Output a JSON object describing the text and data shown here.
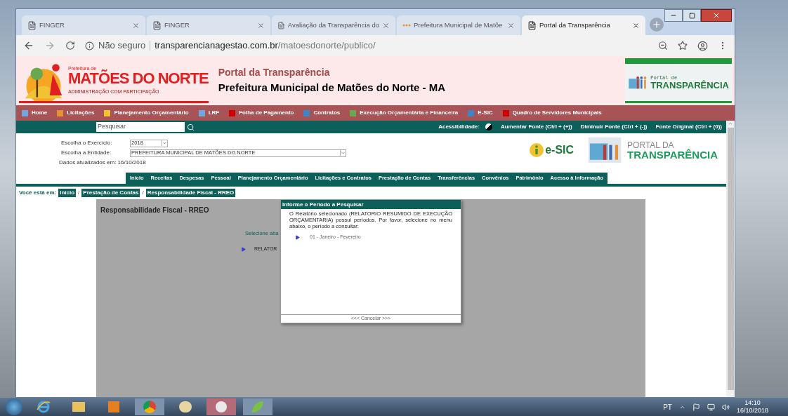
{
  "browser": {
    "tabs": [
      {
        "title": "FINGER",
        "kind": "page",
        "selected": false
      },
      {
        "title": "FINGER",
        "kind": "page",
        "selected": false
      },
      {
        "title": "Avaliação da Transparência do",
        "kind": "page",
        "selected": false
      },
      {
        "title": "Prefeitura Municipal de Matõe",
        "kind": "loading",
        "selected": false
      },
      {
        "title": "Portal da Transparência",
        "kind": "page",
        "selected": true
      }
    ],
    "address": {
      "security": "Não seguro",
      "domain": "transparencianagestao.com.br",
      "path": "/matoesdonorte/publico/"
    }
  },
  "header": {
    "logo": {
      "small": "Prefeitura de",
      "name": "MATÕES DO NORTE",
      "tagline": "ADMINISTRAÇÃO COM PARTICIPAÇÃO"
    },
    "subtitle": "Portal da Transparência",
    "title": "Prefeitura Municipal de Matões do Norte - MA",
    "badge": {
      "small": "Portal de",
      "big": "TRANSPARÊNCIA"
    }
  },
  "top_menu": [
    "Home",
    "Licitações",
    "Planejamento Orçamentário",
    "LRF",
    "Folha de Pagamento",
    "Contratos",
    "Execução Orçamentária e Financeira",
    "E-SIC",
    "Quadro de Servidores Municipais"
  ],
  "toolbar": {
    "search_placeholder": "Pesquisar",
    "accessibility_label": "Acessibilidade:",
    "links": [
      "Aumentar Fonte (Ctrl + (+))",
      "Diminuir Fonte (Ctrl + (-))",
      "Fonte Original (Ctrl + (0))"
    ]
  },
  "filters": [
    {
      "label": "Escolha o Exercício:",
      "value": "2018"
    },
    {
      "label": "Escolha a Entidade:",
      "value": "PREFEITURA MUNICIPAL DE MATÕES DO NORTE"
    }
  ],
  "updated": "Dados atualizados em: 16/10/2018",
  "esic": "e-SIC",
  "portal": {
    "line1": "PORTAL DA",
    "line2": "TRANSPARÊNCIA"
  },
  "nav": [
    "Início",
    "Receitas",
    "Despesas",
    "Pessoal",
    "Planejamento Orçamentário",
    "Licitações e Contratos",
    "Prestação de Contas",
    "Transferências",
    "Convênios",
    "Patrimônio",
    "Acesso à Informação"
  ],
  "breadcrumb": {
    "label": "Você está em:",
    "separator": "/",
    "items": [
      "Início",
      "Prestação de Contas",
      "Responsabilidade Fiscal - RREO"
    ]
  },
  "content": {
    "title": "Responsabilidade Fiscal - RREO",
    "hint": "Selecione aba",
    "item": "RELATOR"
  },
  "modal": {
    "title": "Informe o Período a Pesquisar",
    "text": "O Relatório selecionado (RELATORIO RESUMIDO DE EXECUÇÃO ORÇAMENTARIA) possui períodos. Por favor, selecione no menu abaixo, o período a consultar:",
    "options": [
      "01 - Janeiro - Fevereiro"
    ],
    "cancel": "<<< Cancelar >>>"
  },
  "taskbar": {
    "language": "PT",
    "time": "14:10",
    "date": "16/10/2018"
  }
}
